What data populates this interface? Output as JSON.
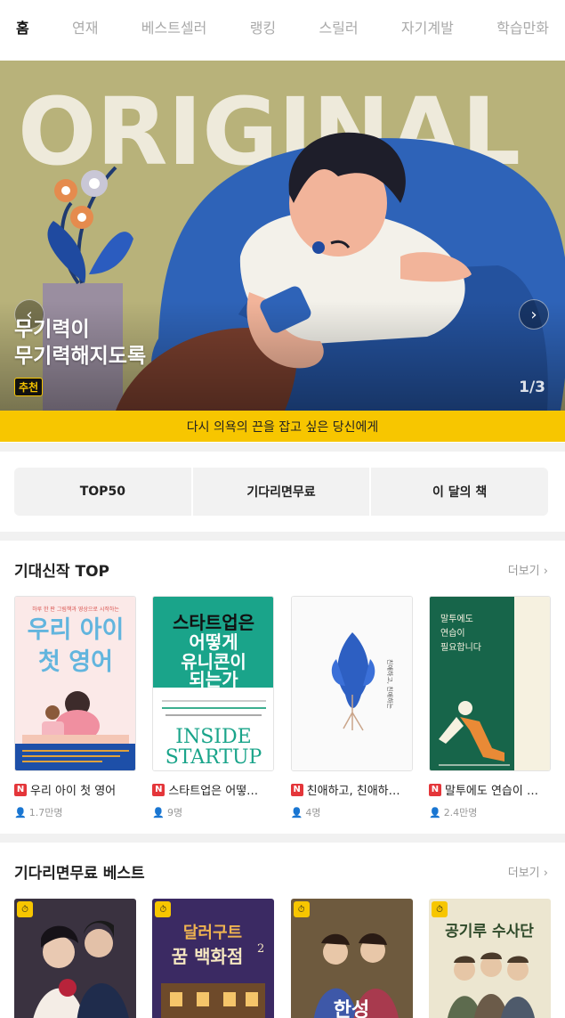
{
  "nav": {
    "tabs": [
      "홈",
      "연재",
      "베스트셀러",
      "랭킹",
      "스릴러",
      "자기계발",
      "학습만화"
    ]
  },
  "hero": {
    "watermark": "ORIGINAL",
    "title_line1": "무기력이",
    "title_line2": "무기력해지도록",
    "badge": "추천",
    "counter": "1/3",
    "tagline": "다시 의욕의 끈을 잡고 싶은 당신에게",
    "accent_color": "#f7c600"
  },
  "quick_links": [
    "TOP50",
    "기다리면무료",
    "이 달의 책"
  ],
  "new_top": {
    "title": "기대신작 TOP",
    "more": "더보기",
    "books": [
      {
        "badge": "N",
        "title": "우리 아이 첫 영어",
        "views": "1.7만명",
        "cover": {
          "line1": "우리 아이",
          "line2": "첫 영어",
          "top": "하루 한 판 그림책과 영상으로 시작하는"
        }
      },
      {
        "badge": "N",
        "title": "스타트업은 어떻…",
        "views": "9명",
        "cover": {
          "line1": "스타트업은",
          "line2": "어떻게",
          "line3": "유니콘이",
          "line4": "되는가",
          "sub1": "INSIDE",
          "sub2": "STARTUP"
        }
      },
      {
        "badge": "N",
        "title": "친애하고, 친애하…",
        "views": "4명",
        "cover": {
          "line1": "친애하고, 친애하는"
        }
      },
      {
        "badge": "N",
        "title": "말투에도 연습이 …",
        "views": "2.4만명",
        "cover": {
          "line1": "말투에도",
          "line2": "연습이",
          "line3": "필요합니다"
        }
      }
    ]
  },
  "wait_free": {
    "title": "기다리면무료 베스트",
    "more": "더보기",
    "books": [
      {
        "badge": "W"
      },
      {
        "badge": "W",
        "cover": {
          "line1": "달러구트",
          "line2": "꿈 백화점",
          "num": "2"
        }
      },
      {
        "badge": "W",
        "cover": {
          "line1": "한성"
        }
      },
      {
        "badge": "W",
        "cover": {
          "line1": "공기루 수사단"
        }
      }
    ]
  }
}
